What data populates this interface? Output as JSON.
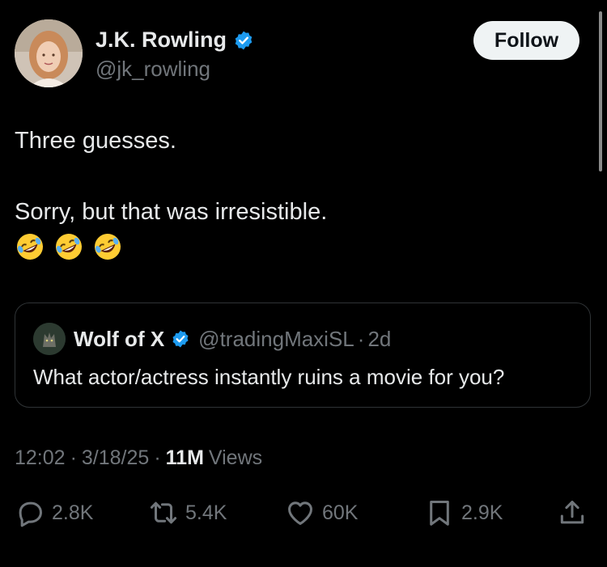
{
  "author": {
    "display_name": "J.K. Rowling",
    "handle": "@jk_rowling",
    "verified_icon": "verified-badge-icon"
  },
  "follow_label": "Follow",
  "tweet": {
    "line1": "Three guesses.",
    "line2": "Sorry, but that was irresistible.",
    "emojis": [
      "rolling-on-floor-laughing",
      "rolling-on-floor-laughing",
      "rolling-on-floor-laughing"
    ]
  },
  "quote": {
    "display_name": "Wolf of X",
    "handle": "@tradingMaxiSL",
    "separator": "·",
    "time": "2d",
    "text": "What actor/actress instantly ruins a movie for you?"
  },
  "meta": {
    "time": "12:02",
    "date": "3/18/25",
    "views_count": "11M",
    "views_label": "Views",
    "separator": "·"
  },
  "actions": {
    "replies": "2.8K",
    "reposts": "5.4K",
    "likes": "60K",
    "bookmarks": "2.9K"
  },
  "colors": {
    "background": "#000000",
    "text": "#e7e9ea",
    "muted": "#71767b",
    "verified": "#1d9bf0",
    "border": "#2f3336"
  }
}
